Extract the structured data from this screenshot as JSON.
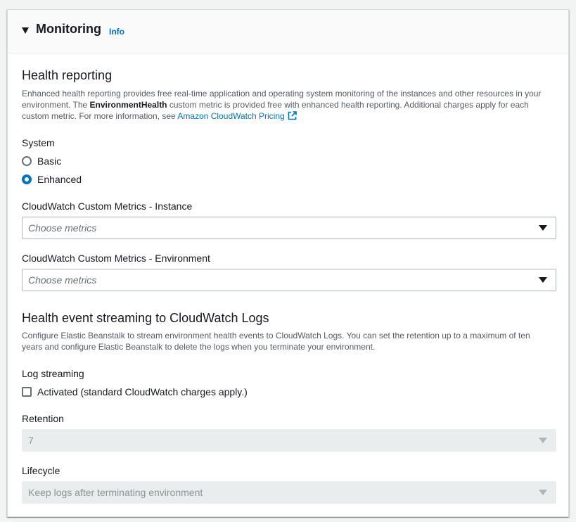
{
  "panel": {
    "title": "Monitoring",
    "info_label": "Info"
  },
  "health_reporting": {
    "heading": "Health reporting",
    "desc_prefix": "Enhanced health reporting provides free real-time application and operating system monitoring of the instances and other resources in your environment. The ",
    "desc_bold": "EnvironmentHealth",
    "desc_suffix": " custom metric is provided free with enhanced health reporting. Additional charges apply for each custom metric. For more information, see ",
    "desc_link": "Amazon CloudWatch Pricing",
    "system_label": "System",
    "options": [
      {
        "label": "Basic",
        "selected": false
      },
      {
        "label": "Enhanced",
        "selected": true
      }
    ],
    "instance_metrics_label": "CloudWatch Custom Metrics - Instance",
    "instance_metrics_placeholder": "Choose metrics",
    "environment_metrics_label": "CloudWatch Custom Metrics - Environment",
    "environment_metrics_placeholder": "Choose metrics"
  },
  "log_streaming": {
    "heading": "Health event streaming to CloudWatch Logs",
    "description": "Configure Elastic Beanstalk to stream environment health events to CloudWatch Logs. You can set the retention up to a maximum of ten years and configure Elastic Beanstalk to delete the logs when you terminate your environment.",
    "streaming_label": "Log streaming",
    "activated_label": "Activated (standard CloudWatch charges apply.)",
    "activated": false,
    "retention_label": "Retention",
    "retention_value": "7",
    "lifecycle_label": "Lifecycle",
    "lifecycle_value": "Keep logs after terminating environment"
  },
  "colors": {
    "accent": "#0073bb",
    "text": "#16191f",
    "muted": "#545b64",
    "disabled_bg": "#eaeded"
  }
}
